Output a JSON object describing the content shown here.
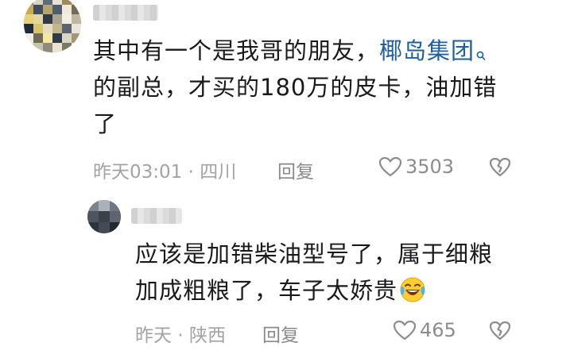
{
  "comment": {
    "text_lines": [
      "其中有一个是我哥的朋友，",
      "的副总，才买的180万的皮卡，油加错",
      "了"
    ],
    "tag": "椰岛集团",
    "time": "昨天03:01",
    "separator": "·",
    "location": "四川",
    "reply_label": "回复",
    "likes": "3503",
    "icons": [
      "heart-icon",
      "broken-heart-icon",
      "search-icon"
    ]
  },
  "reply": {
    "text_lines": [
      "应该是加错柴油型号了，属于细粮",
      "加成粗粮了，车子太娇贵"
    ],
    "emoji": "laughing-crying-emoji",
    "time": "昨天",
    "separator": "·",
    "location": "陕西",
    "reply_label": "回复",
    "likes": "465",
    "icons": [
      "heart-icon",
      "broken-heart-icon"
    ]
  },
  "colors": {
    "text": "#1a1a1a",
    "meta": "#a3a3a3",
    "link": "#1f5f9e",
    "icon": "#8c8c8c"
  }
}
